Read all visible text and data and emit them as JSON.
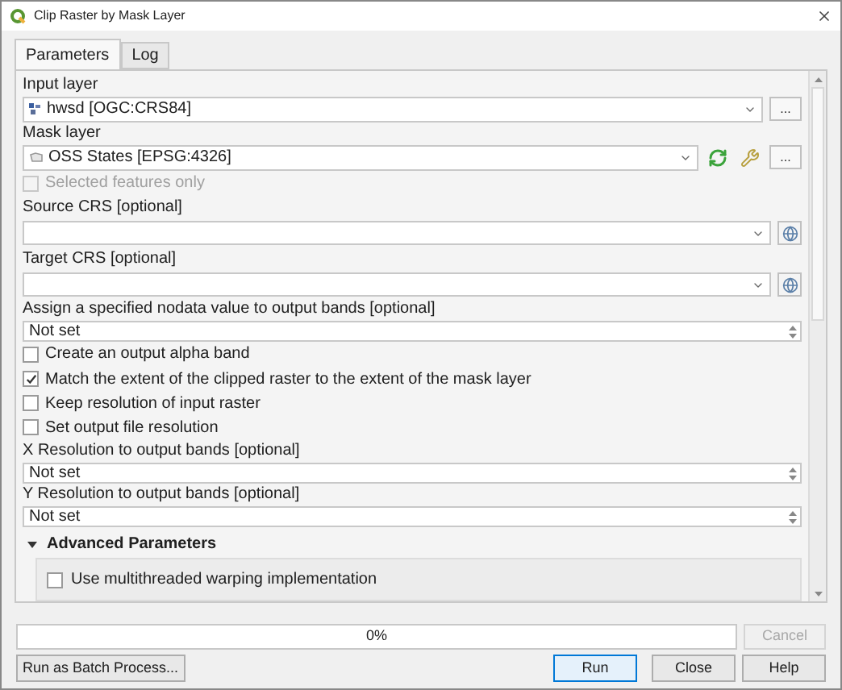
{
  "window": {
    "title": "Clip Raster by Mask Layer"
  },
  "tabs": [
    {
      "label": "Parameters",
      "selected": true
    },
    {
      "label": "Log",
      "selected": false
    }
  ],
  "parameters": [
    {
      "kind": "layer",
      "label": "Input layer",
      "value": "hwsd [OGC:CRS84]",
      "raster_layer": true,
      "button": "...",
      "tools": false
    },
    {
      "kind": "layer",
      "label": "Mask layer",
      "value": "OSS States [EPSG:4326]",
      "raster_layer": false,
      "button": "...",
      "tools": true
    },
    {
      "kind": "checkbox",
      "label": "Selected features only",
      "checked": false,
      "disabled": true
    },
    {
      "kind": "crs",
      "label": "Source CRS [optional]"
    },
    {
      "kind": "crs",
      "label": "Target CRS [optional]"
    },
    {
      "kind": "spin",
      "label": "Assign a specified nodata value to output bands [optional]",
      "value": "Not set"
    },
    {
      "kind": "checkbox",
      "label": "Create an output alpha band",
      "checked": false,
      "disabled": false
    },
    {
      "kind": "checkbox",
      "label": "Match the extent of the clipped raster to the extent of the mask layer",
      "checked": true,
      "disabled": false
    },
    {
      "kind": "checkbox",
      "label": "Keep resolution of input raster",
      "checked": false,
      "disabled": false
    },
    {
      "kind": "checkbox",
      "label": "Set output file resolution",
      "checked": false,
      "disabled": false
    },
    {
      "kind": "spin",
      "label": "X Resolution to output bands [optional]",
      "value": "Not set"
    },
    {
      "kind": "spin",
      "label": "Y Resolution to output bands [optional]",
      "value": "Not set"
    }
  ],
  "advanced": {
    "title": "Advanced Parameters",
    "expanded": true,
    "options": [
      {
        "label": "Use multithreaded warping implementation",
        "checked": false
      }
    ]
  },
  "progress": {
    "level": 0,
    "text": "0%"
  },
  "buttons": {
    "cancel": {
      "label": "Cancel",
      "disabled": true
    },
    "batch": "Run as Batch Process...",
    "run": "Run",
    "close": "Close",
    "help": "Help"
  }
}
